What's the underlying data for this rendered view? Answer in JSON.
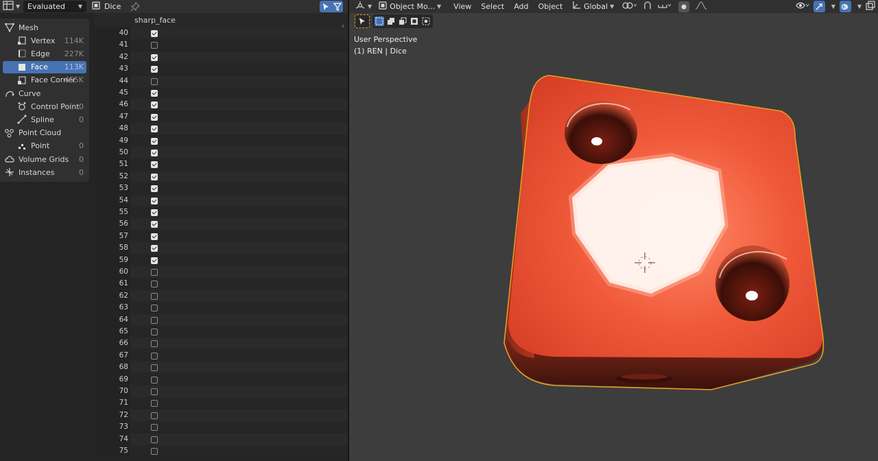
{
  "spreadsheet": {
    "header": {
      "evaluated_label": "Evaluated",
      "object_name": "Dice"
    },
    "sidebar": {
      "items": [
        {
          "label": "Mesh",
          "count": "",
          "level": "top",
          "icon": "mesh-icon",
          "selected": false
        },
        {
          "label": "Vertex",
          "count": "114K",
          "level": "child",
          "icon": "vertex-icon",
          "selected": false
        },
        {
          "label": "Edge",
          "count": "227K",
          "level": "child",
          "icon": "edge-icon",
          "selected": false
        },
        {
          "label": "Face",
          "count": "113K",
          "level": "child",
          "icon": "face-icon",
          "selected": true
        },
        {
          "label": "Face Corner",
          "count": "455K",
          "level": "child",
          "icon": "face-corner-icon",
          "selected": false
        },
        {
          "label": "Curve",
          "count": "",
          "level": "top",
          "icon": "curve-icon",
          "selected": false
        },
        {
          "label": "Control Point",
          "count": "0",
          "level": "child",
          "icon": "control-point-icon",
          "selected": false
        },
        {
          "label": "Spline",
          "count": "0",
          "level": "child",
          "icon": "spline-icon",
          "selected": false
        },
        {
          "label": "Point Cloud",
          "count": "",
          "level": "top",
          "icon": "point-cloud-icon",
          "selected": false
        },
        {
          "label": "Point",
          "count": "0",
          "level": "child",
          "icon": "point-icon",
          "selected": false
        },
        {
          "label": "Volume Grids",
          "count": "0",
          "level": "top",
          "icon": "volume-icon",
          "selected": false
        },
        {
          "label": "Instances",
          "count": "0",
          "level": "top",
          "icon": "instances-icon",
          "selected": false
        }
      ]
    },
    "table": {
      "column": "sharp_face",
      "rows": [
        {
          "index": "40",
          "value": true
        },
        {
          "index": "41",
          "value": false
        },
        {
          "index": "42",
          "value": true
        },
        {
          "index": "43",
          "value": true
        },
        {
          "index": "44",
          "value": false
        },
        {
          "index": "45",
          "value": true
        },
        {
          "index": "46",
          "value": true
        },
        {
          "index": "47",
          "value": true
        },
        {
          "index": "48",
          "value": true
        },
        {
          "index": "49",
          "value": true
        },
        {
          "index": "50",
          "value": true
        },
        {
          "index": "51",
          "value": true
        },
        {
          "index": "52",
          "value": true
        },
        {
          "index": "53",
          "value": true
        },
        {
          "index": "54",
          "value": true
        },
        {
          "index": "55",
          "value": true
        },
        {
          "index": "56",
          "value": true
        },
        {
          "index": "57",
          "value": true
        },
        {
          "index": "58",
          "value": true
        },
        {
          "index": "59",
          "value": true
        },
        {
          "index": "60",
          "value": false
        },
        {
          "index": "61",
          "value": false
        },
        {
          "index": "62",
          "value": false
        },
        {
          "index": "63",
          "value": false
        },
        {
          "index": "64",
          "value": false
        },
        {
          "index": "65",
          "value": false
        },
        {
          "index": "66",
          "value": false
        },
        {
          "index": "67",
          "value": false
        },
        {
          "index": "68",
          "value": false
        },
        {
          "index": "69",
          "value": false
        },
        {
          "index": "70",
          "value": false
        },
        {
          "index": "71",
          "value": false
        },
        {
          "index": "72",
          "value": false
        },
        {
          "index": "73",
          "value": false
        },
        {
          "index": "74",
          "value": false
        },
        {
          "index": "75",
          "value": false
        }
      ]
    }
  },
  "viewport": {
    "header": {
      "mode_label": "Object Mo...",
      "menus": [
        "View",
        "Select",
        "Add",
        "Object"
      ],
      "orientation_label": "Global"
    },
    "overlay": {
      "perspective": "User Perspective",
      "object_info": "(1) REN | Dice"
    },
    "colors": {
      "dice_main": "#e2452c",
      "dice_shadow": "#5a1a12",
      "outline": "#e8a020",
      "accent": "#4772b3"
    }
  }
}
